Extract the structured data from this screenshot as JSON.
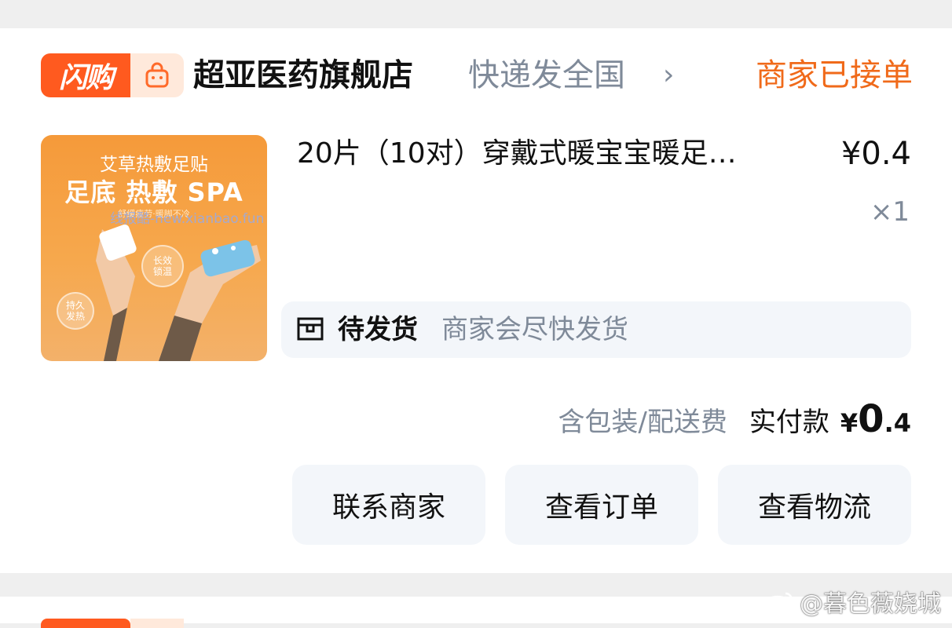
{
  "order": {
    "badge": {
      "text": "闪购"
    },
    "store": {
      "name": "超亚医药旗舰店",
      "shipping": "快递发全国",
      "arrow": "›"
    },
    "status": "商家已接单",
    "product": {
      "image": {
        "line1": "艾草热敷足贴",
        "line2": "足底 热敷 SPA",
        "line3": "舒缓疲劳·暖脚不冷",
        "bubble_a": "长效\n锁温",
        "bubble_b": "持久\n发热"
      },
      "title": "20片（10对）穿戴式暖宝宝暖足…",
      "price": "¥0.4",
      "quantity": "×1"
    },
    "shipping_status": {
      "label": "待发货",
      "desc": "商家会尽快发货"
    },
    "total": {
      "fee_note": "含包装/配送费",
      "paid_label": "实付款",
      "currency": "¥",
      "amount_int": "0",
      "amount_dec": ".4"
    },
    "buttons": {
      "contact": "联系商家",
      "view_order": "查看订单",
      "view_logistics": "查看物流"
    }
  },
  "watermarks": {
    "image_overlay": "线报酷-new.xianbao.fun",
    "weibo": "@暮色薇娆城"
  },
  "colors": {
    "accent": "#ff5a1f",
    "status": "#f06a1a",
    "muted": "#7f8a99",
    "panel": "#f3f6fa"
  },
  "icons": [
    "shopping-bag-icon",
    "chevron-right-icon",
    "package-box-icon",
    "weibo-icon"
  ]
}
